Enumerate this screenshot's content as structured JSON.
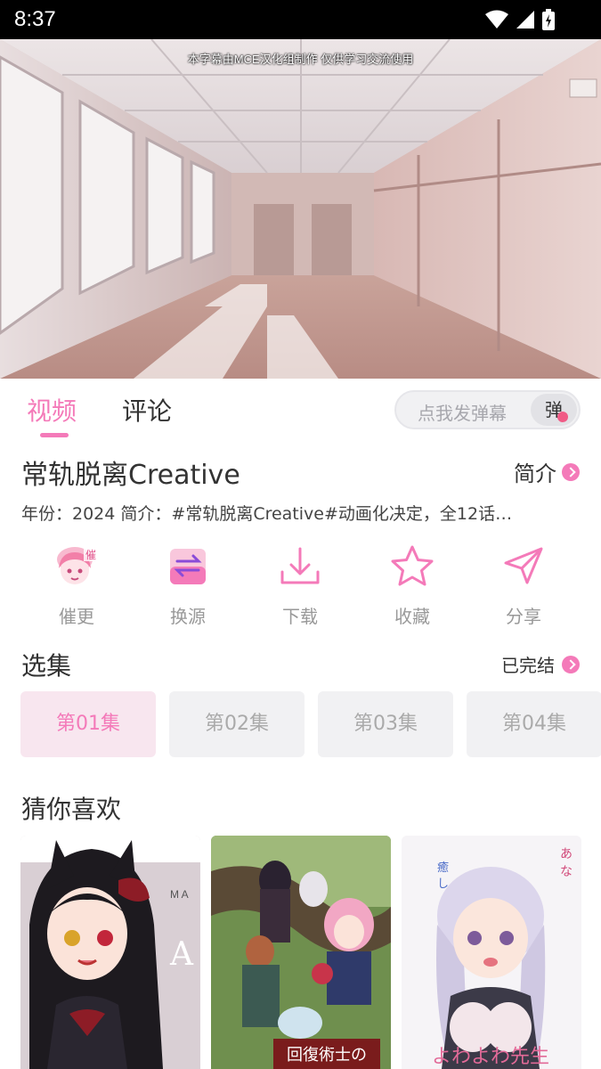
{
  "status_bar": {
    "time": "8:37"
  },
  "video": {
    "subtitle": "本字幕由MCE汉化组制作 仅供学习交流使用"
  },
  "tabs": [
    {
      "label": "视频",
      "active": true
    },
    {
      "label": "评论",
      "active": false
    }
  ],
  "danmaku": {
    "placeholder": "点我发弹幕",
    "button_label": "弹"
  },
  "anime": {
    "title": "常轨脱离Creative",
    "intro_link": "简介",
    "meta": "年份：2024  简介：#常轨脱离Creative#动画化决定，全12话…"
  },
  "actions": [
    {
      "label": "催更",
      "icon": "mascot-icon"
    },
    {
      "label": "换源",
      "icon": "switch-source-icon"
    },
    {
      "label": "下载",
      "icon": "download-icon"
    },
    {
      "label": "收藏",
      "icon": "star-icon"
    },
    {
      "label": "分享",
      "icon": "share-icon"
    }
  ],
  "episodes_section": {
    "title": "选集",
    "status": "已完结",
    "episodes": [
      "第01集",
      "第02集",
      "第03集",
      "第04集"
    ],
    "selected_index": 0
  },
  "recommendations": {
    "title": "猜你喜欢"
  },
  "colors": {
    "accent": "#f47ab9",
    "text": "#333333",
    "muted": "#999999"
  }
}
